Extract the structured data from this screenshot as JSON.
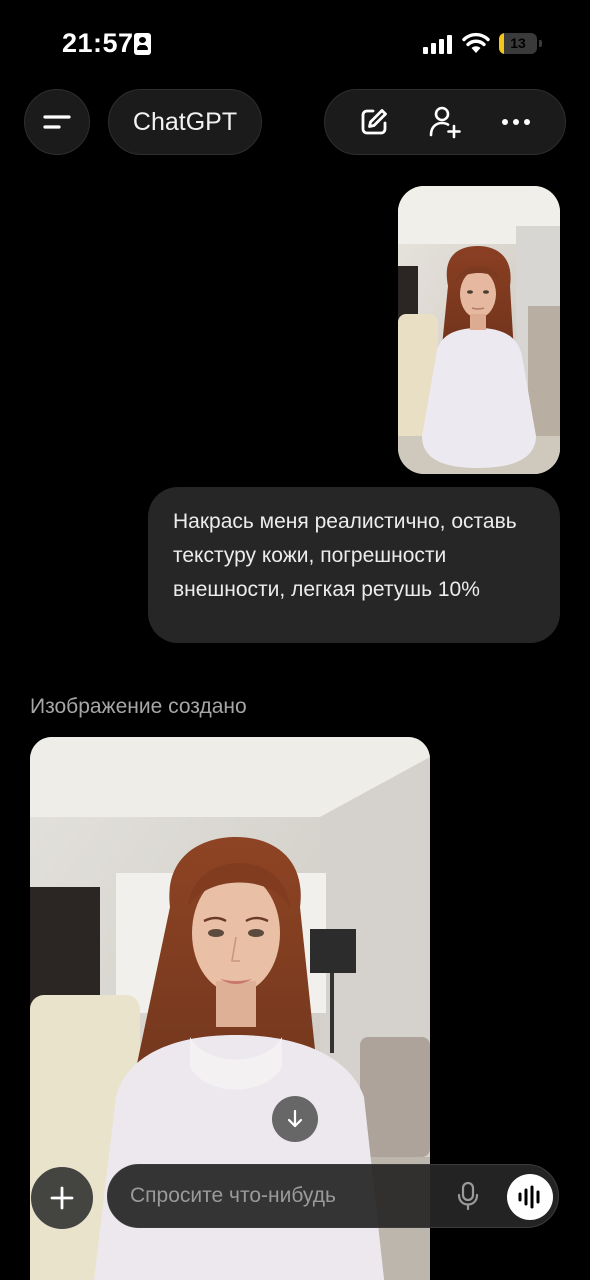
{
  "status": {
    "time": "21:57",
    "battery_level": "13",
    "battery_fraction": 0.13,
    "battery_color": "#f5c518"
  },
  "header": {
    "title": "ChatGPT",
    "menu_icon": "sidebar-menu-icon",
    "actions": [
      "new-chat-icon",
      "add-person-icon",
      "more-icon"
    ]
  },
  "chat": {
    "user_message": "Накрась меня реалистично, оставь текстуру кожи, погрешности внешности, легкая ретушь 10%",
    "assistant_label": "Изображение создано"
  },
  "composer": {
    "placeholder": "Спросите что-нибудь",
    "value": ""
  },
  "colors": {
    "background": "#000000",
    "bubble": "#262626",
    "pill": "#1b1b1b"
  }
}
